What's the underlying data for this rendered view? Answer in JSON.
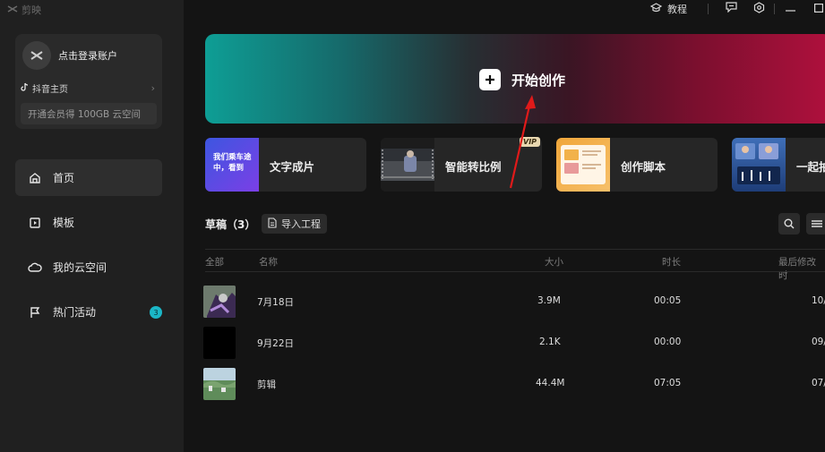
{
  "app": {
    "name": "剪映",
    "logo_icon": "capcut-logo-icon"
  },
  "topbar": {
    "tutorial_label": "教程"
  },
  "account": {
    "login_label": "点击登录账户",
    "douyin_label": "抖音主页",
    "vip_promo": "开通会员得 100GB 云空间"
  },
  "nav": {
    "items": [
      {
        "label": "首页",
        "icon": "home-icon",
        "active": true
      },
      {
        "label": "模板",
        "icon": "template-icon"
      },
      {
        "label": "我的云空间",
        "icon": "cloud-icon"
      },
      {
        "label": "热门活动",
        "icon": "flag-icon",
        "badge": "3"
      }
    ]
  },
  "hero": {
    "label": "开始创作",
    "icon": "plus-icon"
  },
  "cards": [
    {
      "label": "文字成片",
      "thumb_text": "我们乘车途中，看到"
    },
    {
      "label": "智能转比例",
      "tag": "VIP"
    },
    {
      "label": "创作脚本"
    },
    {
      "label": "一起拍"
    }
  ],
  "drafts": {
    "title": "草稿（3）",
    "import_label": "导入工程",
    "columns": {
      "all": "全部",
      "name": "名称",
      "size": "大小",
      "duration": "时长",
      "modified": "最后修改时"
    },
    "rows": [
      {
        "name": "7月18日",
        "size": "3.9M",
        "duration": "00:05",
        "modified": "10/"
      },
      {
        "name": "9月22日",
        "size": "2.1K",
        "duration": "00:00",
        "modified": "09/"
      },
      {
        "name": "剪辑",
        "size": "44.4M",
        "duration": "07:05",
        "modified": "07/"
      }
    ]
  },
  "colors": {
    "accent": "#1bb6c6",
    "hero_left": "#0e9e95",
    "hero_right": "#b0103d",
    "annotation_arrow": "#e01a1a"
  }
}
